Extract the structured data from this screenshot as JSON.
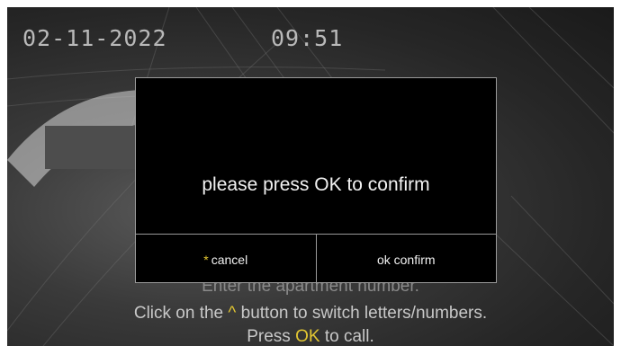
{
  "status": {
    "date": "02-11-2022",
    "time": "09:51"
  },
  "dialog": {
    "message": "please press OK to confirm",
    "cancel_marker": "*",
    "cancel_label": "cancel",
    "confirm_label": "ok confirm"
  },
  "instructions": {
    "line1": "Enter the apartment number.",
    "line2_before": "Click on the",
    "line2_key": "^",
    "line2_after": "button to switch letters/numbers.",
    "line3_before": "Press",
    "line3_key": "OK",
    "line3_after": "to call."
  },
  "colors": {
    "accent": "#e2c632",
    "dialog_bg": "#000000",
    "dialog_border": "#9a9a9a"
  }
}
